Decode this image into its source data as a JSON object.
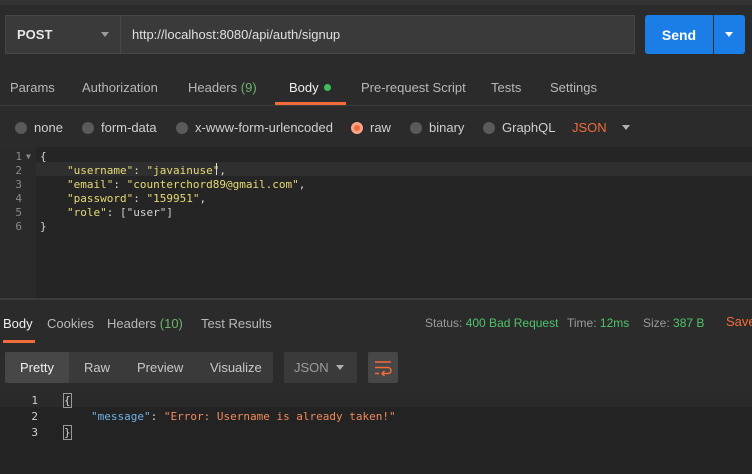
{
  "request": {
    "method": "POST",
    "url": "http://localhost:8080/api/auth/signup",
    "send_label": "Send"
  },
  "tabs": [
    {
      "label": "Params"
    },
    {
      "label": "Authorization"
    },
    {
      "label": "Headers",
      "count": "(9)"
    },
    {
      "label": "Body"
    },
    {
      "label": "Pre-request Script"
    },
    {
      "label": "Tests"
    },
    {
      "label": "Settings"
    }
  ],
  "body_types": [
    {
      "label": "none"
    },
    {
      "label": "form-data"
    },
    {
      "label": "x-www-form-urlencoded"
    },
    {
      "label": "raw",
      "selected": true
    },
    {
      "label": "binary"
    },
    {
      "label": "GraphQL"
    }
  ],
  "raw_format": "JSON",
  "request_body": {
    "line_numbers": [
      "1",
      "2",
      "3",
      "4",
      "5",
      "6"
    ],
    "open_brace": "{",
    "close_brace": "}",
    "fields": [
      {
        "key": "\"username\"",
        "value": "\"javainuse\"",
        "trail": ","
      },
      {
        "key": "\"email\"",
        "value": "\"counterchord89@gmail.com\"",
        "trail": ","
      },
      {
        "key": "\"password\"",
        "value": "\"159951\"",
        "trail": ","
      },
      {
        "key": "\"role\"",
        "value": "[\"user\"]",
        "trail": ""
      }
    ]
  },
  "response": {
    "tabs": [
      {
        "label": "Body"
      },
      {
        "label": "Cookies"
      },
      {
        "label": "Headers",
        "count": "(10)"
      },
      {
        "label": "Test Results"
      }
    ],
    "status_label": "Status:",
    "status_value": "400 Bad Request",
    "time_label": "Time:",
    "time_value": "12ms",
    "size_label": "Size:",
    "size_value": "387 B",
    "save_label": "Save",
    "views": [
      "Pretty",
      "Raw",
      "Preview",
      "Visualize"
    ],
    "format": "JSON",
    "line_numbers": [
      "1",
      "2",
      "3"
    ],
    "open_brace": "{",
    "close_brace": "}",
    "message_key": "\"message\"",
    "message_value": "\"Error: Username is already taken!\""
  },
  "colors": {
    "accent": "#f26b3a",
    "send": "#1a7ee6",
    "status_ok_text": "#4fc36a"
  }
}
